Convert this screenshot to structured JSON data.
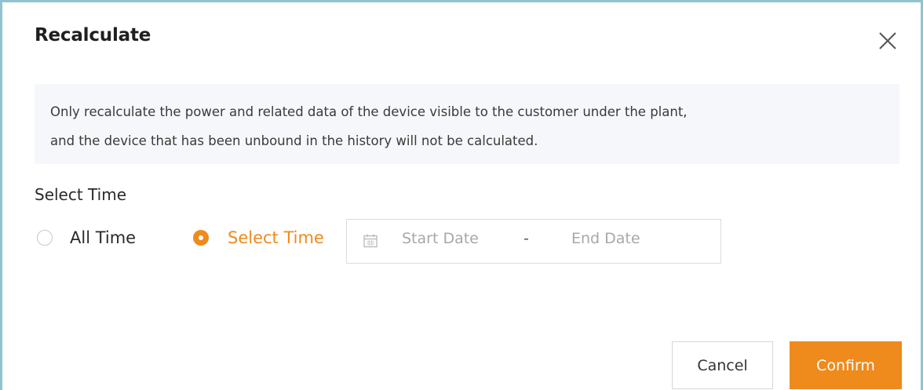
{
  "dialog": {
    "title": "Recalculate",
    "notice_line1": "Only recalculate the power and related data of the device visible to the customer under the plant,",
    "notice_line2": "and the device that has been unbound in the history will not be calculated.",
    "select_time_label": "Select Time",
    "options": [
      {
        "label": "All Time",
        "selected": false
      },
      {
        "label": "Select Time",
        "selected": true
      }
    ],
    "date_range": {
      "start_placeholder": "Start Date",
      "separator": "-",
      "end_placeholder": "End Date",
      "icon": "calendar-icon"
    },
    "buttons": {
      "cancel": "Cancel",
      "confirm": "Confirm"
    },
    "close_icon": "close-icon"
  },
  "colors": {
    "accent": "#ef8a1c",
    "frame_border": "#8fc4cf",
    "notice_bg": "#f6f7fa",
    "placeholder_text": "#a8a8a8"
  }
}
